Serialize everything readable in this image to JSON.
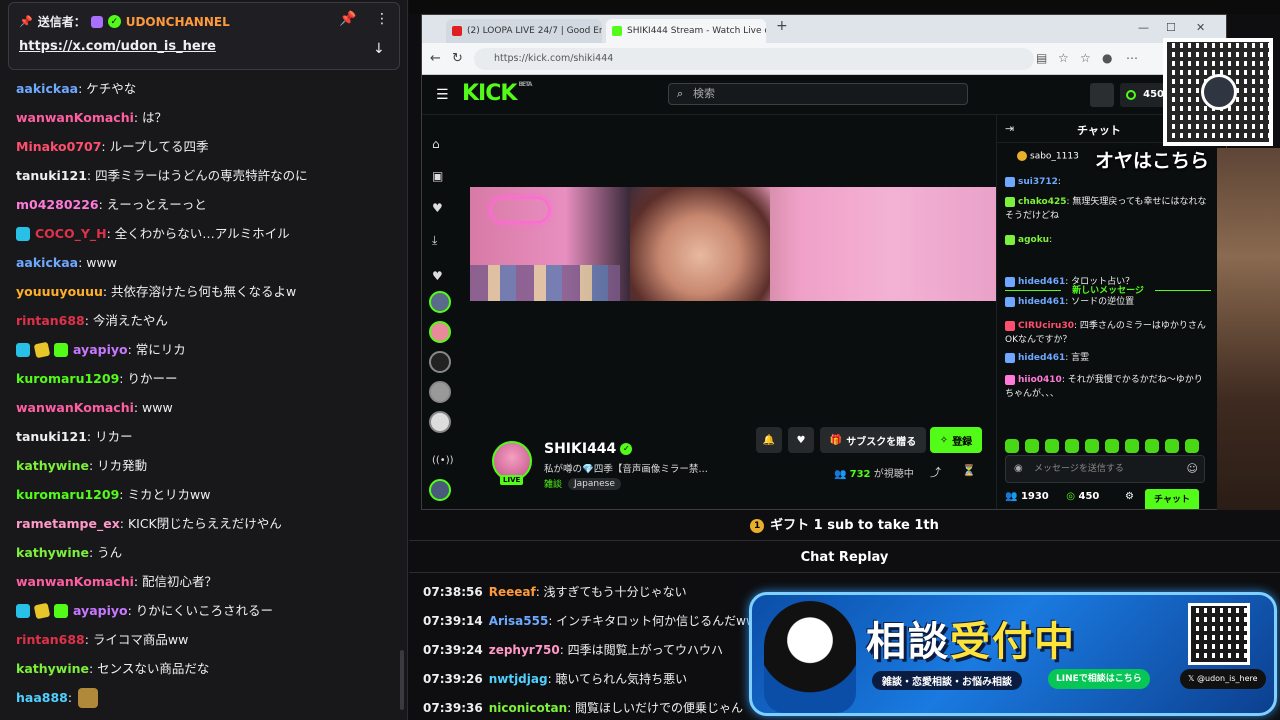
{
  "left_chat": {
    "pinned": {
      "sender_label": "送信者：",
      "channel": "UDONCHANNEL",
      "link": "https://x.com/udon_is_here"
    },
    "messages": [
      {
        "user": "aakickaa",
        "color": "#6ea8ff",
        "text": ": ケチやな",
        "badges": []
      },
      {
        "user": "wanwanKomachi",
        "color": "#ff5fa2",
        "text": ": は？",
        "badges": []
      },
      {
        "user": "Minako0707",
        "color": "#ff4f6e",
        "text": ": ループしてる四季",
        "badges": []
      },
      {
        "user": "tanuki121",
        "color": "#efeff1",
        "text": ": 四季ミラーはうどんの専売特許なのに",
        "badges": []
      },
      {
        "user": "m04280226",
        "color": "#ff7ad9",
        "text": ": えーっとえーっと",
        "badges": []
      },
      {
        "user": "COCO_Y_H",
        "color": "#e0314a",
        "text": ": 全くわからない…アルミホイル",
        "badges": [
          "sub"
        ]
      },
      {
        "user": "aakickaa",
        "color": "#6ea8ff",
        "text": ": www",
        "badges": []
      },
      {
        "user": "youuuyouuu",
        "color": "#ffb02a",
        "text": ": 共依存溶けたら何も無くなるよw",
        "badges": []
      },
      {
        "user": "rintan688",
        "color": "#e0314a",
        "text": ": 今消えたやん",
        "badges": []
      },
      {
        "user": "ayapiyo",
        "color": "#c778ff",
        "text": ": 常にリカ",
        "badges": [
          "sub",
          "gift",
          "grn"
        ]
      },
      {
        "user": "kuromaru1209",
        "color": "#53fc18",
        "text": ": りかーー",
        "badges": []
      },
      {
        "user": "wanwanKomachi",
        "color": "#ff5fa2",
        "text": ": www",
        "badges": []
      },
      {
        "user": "tanuki121",
        "color": "#efeff1",
        "text": ": リカー",
        "badges": []
      },
      {
        "user": "kathywine",
        "color": "#7cf03a",
        "text": ": リカ発動",
        "badges": []
      },
      {
        "user": "kuromaru1209",
        "color": "#53fc18",
        "text": ": ミカとリカww",
        "badges": []
      },
      {
        "user": "rametampe_ex",
        "color": "#ff9ac8",
        "text": ": KICK閉じたらええだけやん",
        "badges": []
      },
      {
        "user": "kathywine",
        "color": "#7cf03a",
        "text": ": うん",
        "badges": []
      },
      {
        "user": "wanwanKomachi",
        "color": "#ff5fa2",
        "text": ": 配信初心者？",
        "badges": []
      },
      {
        "user": "ayapiyo",
        "color": "#c778ff",
        "text": ": りかにくいころされるー",
        "badges": [
          "sub",
          "gift",
          "grn"
        ]
      },
      {
        "user": "rintan688",
        "color": "#e0314a",
        "text": ": ライコマ商品ww",
        "badges": []
      },
      {
        "user": "kathywine",
        "color": "#7cf03a",
        "text": ": センスない商品だな",
        "badges": []
      },
      {
        "user": "haa888",
        "color": "#4fd0ff",
        "text": ":",
        "badges": [
          "emote"
        ]
      }
    ]
  },
  "browser": {
    "tabs": [
      {
        "label": "(2) LOOPA LIVE 24/7 | Good Energy",
        "favicon_color": "#e02020",
        "active": false
      },
      {
        "label": "SHIKI444 Stream - Watch Live on K",
        "favicon_color": "#53fc18",
        "active": true
      }
    ],
    "new_tab": "+",
    "url": "https://kick.com/shiki444"
  },
  "kick": {
    "logo": "KICK",
    "logo_beta": "BETA",
    "search_placeholder": "検索",
    "balance": "450",
    "channel": {
      "name": "SHIKI444",
      "title": "私が噂の💎四季【音声画像ミラー禁…",
      "category": "雑談",
      "language": "Japanese",
      "live": "LIVE",
      "viewers": "732",
      "viewers_suffix": "が視聴中"
    },
    "buttons": {
      "gift_sub": "サブスクを贈る",
      "follow": "登録"
    },
    "chat": {
      "title": "チャット",
      "pinned_user": "sabo_1113",
      "messages": [
        {
          "user": "sui3712",
          "color": "#6ea8ff",
          "text": ":"
        },
        {
          "user": "chako425",
          "color": "#7cf03a",
          "text": ": 無理矢理戻っても幸せにはなれな そうだけどね"
        },
        {
          "user": "agoku",
          "color": "#7cf03a",
          "text": ":"
        },
        {
          "user": "hided461",
          "color": "#6ea8ff",
          "text": ": タロット占い？"
        },
        {
          "user": "hided461",
          "color": "#6ea8ff",
          "text": ": ソードの逆位置"
        },
        {
          "user": "CIRUciru30",
          "color": "#ff4f6e",
          "text": ": 四季さんのミラーはゆかりさん OKなんですか？"
        },
        {
          "user": "hided461",
          "color": "#6ea8ff",
          "text": ": 言霊"
        },
        {
          "user": "hiio0410",
          "color": "#ff7ad9",
          "text": ": それが我慢でかるかだね～ゆかりちゃんが、、、"
        }
      ],
      "new_messages": "新しいメッセージ",
      "input_placeholder": "メッセージを送信する",
      "followers": "1930",
      "points": "450",
      "send": "チャット"
    }
  },
  "overlay": {
    "text": "オヤはこちら"
  },
  "gift_bar": "ギフト 1 sub to take 1th",
  "replay": {
    "title": "Chat Replay",
    "messages": [
      {
        "time": "07:38:56",
        "user": "Reeeaf",
        "color": "#ff9a3c",
        "text": ": 浅すぎてもう十分じゃない"
      },
      {
        "time": "07:39:14",
        "user": "Arisa555",
        "color": "#6ea8ff",
        "text": ": インチキタロット何か信じるんだwww"
      },
      {
        "time": "07:39:24",
        "user": "zephyr750",
        "color": "#ff9ac8",
        "text": ": 四季は閲覧上がってウハウハ"
      },
      {
        "time": "07:39:26",
        "user": "nwtjdjag",
        "color": "#4fd0ff",
        "text": ": 聴いてられん気持ち悪い"
      },
      {
        "time": "07:39:36",
        "user": "niconicotan",
        "color": "#7cf03a",
        "text": ": 閲覧ほしいだけでの便乗じゃん"
      }
    ]
  },
  "banner": {
    "title_a": "相談",
    "title_b": "受付中",
    "subtitle": "雑談・恋愛相談・お悩み相談",
    "line_label": "LINEで相談はこちら",
    "x_handle": "@udon_is_here"
  }
}
